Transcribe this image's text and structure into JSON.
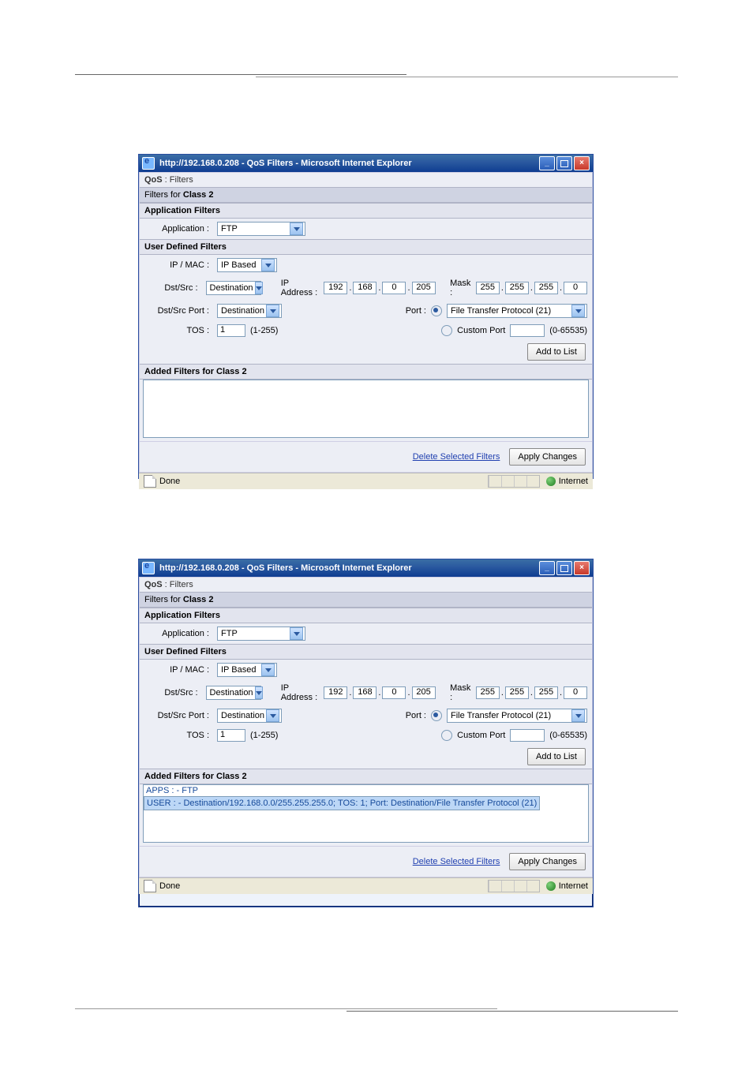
{
  "window": {
    "title": "http://192.168.0.208 - QoS Filters - Microsoft Internet Explorer"
  },
  "page": {
    "heading_prefix": "QoS",
    "heading_sep": " : ",
    "heading_suffix": "Filters",
    "filters_for": "Filters for ",
    "class_label": "Class 2",
    "app_filters": "Application Filters",
    "user_filters": "User Defined Filters",
    "added_filters": "Added Filters for Class 2"
  },
  "labels": {
    "application": "Application :",
    "ipmac": "IP / MAC :",
    "dstsrc": "Dst/Src :",
    "dstsrcport": "Dst/Src Port :",
    "tos": "TOS :",
    "ipaddress": "IP Address :",
    "mask": "Mask :",
    "port": "Port :",
    "custom_port": "Custom Port",
    "tos_range": "(1-255)",
    "custom_range": "(0-65535)"
  },
  "values": {
    "application": "FTP",
    "ipmac": "IP Based",
    "dstsrc": "Destination",
    "dstsrcport": "Destination",
    "tos": "1",
    "ip": {
      "a": "192",
      "b": "168",
      "c": "0",
      "d": "205"
    },
    "mask": {
      "a": "255",
      "b": "255",
      "c": "255",
      "d": "0"
    },
    "port_preset": "File Transfer Protocol (21)",
    "custom_port": ""
  },
  "buttons": {
    "add": "Add to List",
    "apply": "Apply Changes",
    "delete": "Delete Selected Filters"
  },
  "listbox2": {
    "row0": "APPS : - FTP",
    "row1": "USER : - Destination/192.168.0.0/255.255.255.0; TOS: 1; Port: Destination/File Transfer Protocol (21)"
  },
  "status": {
    "done": "Done",
    "zone": "Internet"
  }
}
